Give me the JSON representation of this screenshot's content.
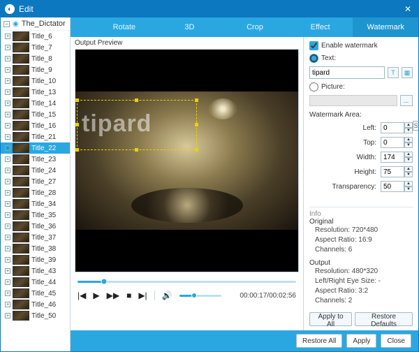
{
  "window": {
    "title": "Edit"
  },
  "sidebar": {
    "root": "The_Dictator",
    "items": [
      {
        "label": "Title_6"
      },
      {
        "label": "Title_7"
      },
      {
        "label": "Title_8"
      },
      {
        "label": "Title_9"
      },
      {
        "label": "Title_10"
      },
      {
        "label": "Title_13"
      },
      {
        "label": "Title_14"
      },
      {
        "label": "Title_15"
      },
      {
        "label": "Title_16"
      },
      {
        "label": "Title_21"
      },
      {
        "label": "Title_22",
        "selected": true
      },
      {
        "label": "Title_23"
      },
      {
        "label": "Title_24"
      },
      {
        "label": "Title_27"
      },
      {
        "label": "Title_28"
      },
      {
        "label": "Title_34"
      },
      {
        "label": "Title_35"
      },
      {
        "label": "Title_36"
      },
      {
        "label": "Title_37"
      },
      {
        "label": "Title_38"
      },
      {
        "label": "Title_39"
      },
      {
        "label": "Title_43"
      },
      {
        "label": "Title_44"
      },
      {
        "label": "Title_45"
      },
      {
        "label": "Title_46"
      },
      {
        "label": "Title_50"
      }
    ]
  },
  "tabs": {
    "items": [
      {
        "label": "Rotate"
      },
      {
        "label": "3D"
      },
      {
        "label": "Crop"
      },
      {
        "label": "Effect"
      },
      {
        "label": "Watermark",
        "active": true
      }
    ]
  },
  "preview": {
    "label": "Output Preview",
    "watermark_text": "tipard",
    "time_current": "00:00:17",
    "time_total": "00:02:56"
  },
  "panel": {
    "enable_label": "Enable watermark",
    "enable_checked": true,
    "text_radio_label": "Text:",
    "text_radio_checked": true,
    "text_value": "tipard",
    "picture_radio_label": "Picture:",
    "picture_radio_checked": false,
    "area_title": "Watermark Area:",
    "left_label": "Left:",
    "left_value": "0",
    "top_label": "Top:",
    "top_value": "0",
    "width_label": "Width:",
    "width_value": "174",
    "height_label": "Height:",
    "height_value": "75",
    "transparency_label": "Transparency:",
    "transparency_value": "50",
    "info_title": "Info",
    "original_title": "Original",
    "original_resolution": "Resolution: 720*480",
    "original_aspect": "Aspect Ratio: 16:9",
    "original_channels": "Channels: 6",
    "output_title": "Output",
    "output_resolution": "Resolution: 480*320",
    "output_eye": "Left/Right Eye Size: -",
    "output_aspect": "Aspect Ratio: 3:2",
    "output_channels": "Channels: 2",
    "apply_to_all": "Apply to All",
    "restore_defaults": "Restore Defaults"
  },
  "footer": {
    "restore_all": "Restore All",
    "apply": "Apply",
    "close": "Close"
  }
}
